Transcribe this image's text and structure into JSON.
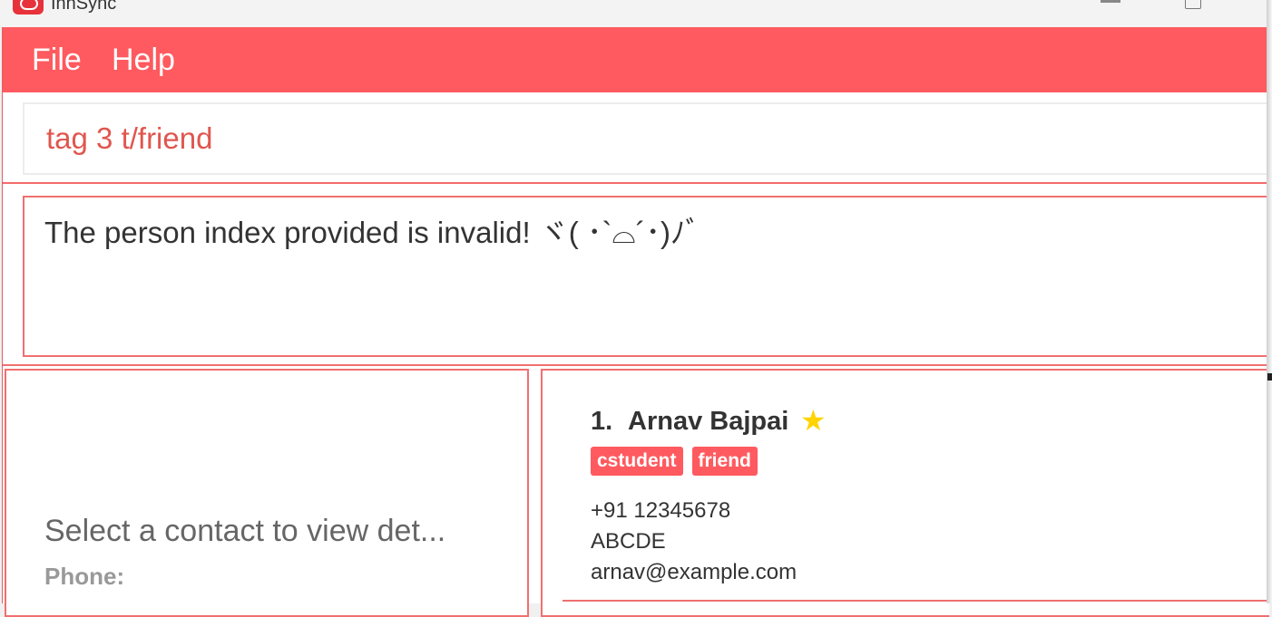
{
  "window": {
    "title": "InnSync"
  },
  "menu": {
    "items": [
      "File",
      "Help"
    ]
  },
  "command": {
    "value": "tag 3 t/friend"
  },
  "result": {
    "message": "The person index provided is invalid! ヾ( ･`⌓´･)ﾉﾞ"
  },
  "detail": {
    "placeholder": "Select a contact to view det...",
    "phone_label": "Phone:"
  },
  "contacts": [
    {
      "index": "1.",
      "name": "Arnav Bajpai",
      "starred": true,
      "star_icon": "star-icon",
      "tags": [
        "cstudent",
        "friend"
      ],
      "phone": "+91 12345678",
      "address": "ABCDE",
      "email": "arnav@example.com"
    }
  ],
  "colors": {
    "accent": "#ff5a5f",
    "border": "#f07070",
    "star": "#ffd400"
  }
}
